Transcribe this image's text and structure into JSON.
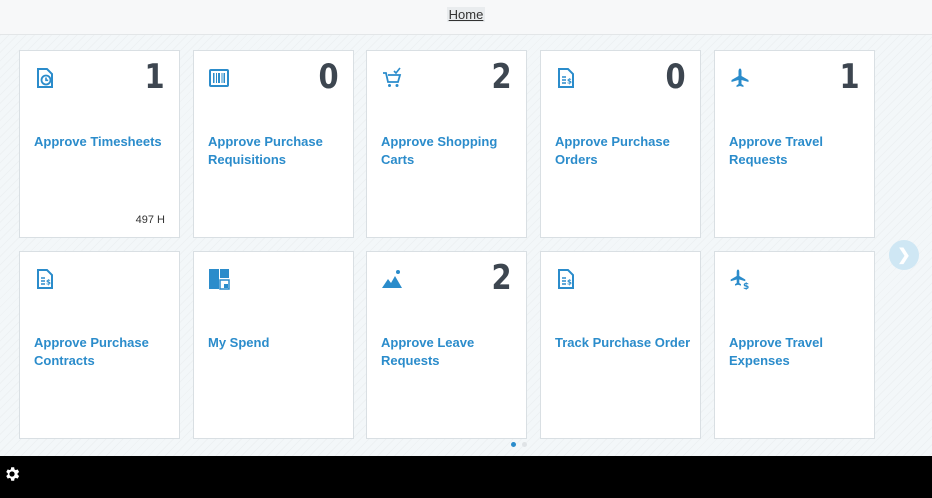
{
  "header": {
    "home_label": "Home"
  },
  "tiles": [
    {
      "title": "Approve Timesheets",
      "count": "1",
      "footer": "497 H",
      "icon": "timesheet-icon"
    },
    {
      "title": "Approve Purchase Requisitions",
      "count": "0",
      "footer": "",
      "icon": "barcode-icon"
    },
    {
      "title": "Approve Shopping Carts",
      "count": "2",
      "footer": "",
      "icon": "cart-icon"
    },
    {
      "title": "Approve Purchase Orders",
      "count": "0",
      "footer": "",
      "icon": "invoice-icon"
    },
    {
      "title": "Approve Travel Requests",
      "count": "1",
      "footer": "",
      "icon": "airplane-icon"
    },
    {
      "title": "Approve Purchase Contracts",
      "count": "",
      "footer": "",
      "icon": "invoice-icon"
    },
    {
      "title": "My Spend",
      "count": "",
      "footer": "",
      "icon": "dashboard-icon"
    },
    {
      "title": "Approve Leave Requests",
      "count": "2",
      "footer": "",
      "icon": "mountain-icon"
    },
    {
      "title": "Track Purchase Order",
      "count": "",
      "footer": "",
      "icon": "invoice-icon"
    },
    {
      "title": "Approve Travel Expenses",
      "count": "",
      "footer": "",
      "icon": "airplane-dollar-icon"
    }
  ],
  "pagination": {
    "active_index": 0,
    "total": 2
  },
  "colors": {
    "accent": "#2b8ccb",
    "count_text": "#3d4650",
    "bottom_bar": "#000000"
  }
}
